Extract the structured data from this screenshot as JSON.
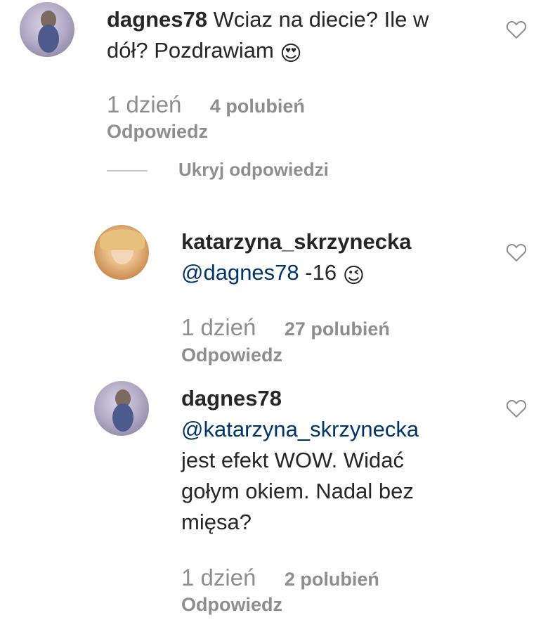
{
  "comments": [
    {
      "username": "dagnes78",
      "text_parts": [
        "Wciaz na diecie? Ile w",
        "dół? Pozdrawiam"
      ],
      "emoji": "😍",
      "time": "1 dzień",
      "likes": "4 polubień",
      "reply": "Odpowiedz"
    },
    {
      "username": "katarzyna_skrzynecka",
      "mention": "@dagnes78",
      "text": "-16",
      "emoji": "😉",
      "time": "1 dzień",
      "likes": "27 polubień",
      "reply": "Odpowiedz"
    },
    {
      "username": "dagnes78",
      "mention": "@katarzyna_skrzynecka",
      "text_lines": [
        "jest efekt WOW. Widać",
        "gołym okiem. Nadal bez",
        "mięsa?"
      ],
      "time": "1 dzień",
      "likes": "2 polubień",
      "reply": "Odpowiedz"
    }
  ],
  "hide_replies": "Ukryj odpowiedzi",
  "icons": {
    "like": "heart-icon"
  },
  "colors": {
    "mention": "#003569",
    "muted": "#8e8e8e"
  }
}
